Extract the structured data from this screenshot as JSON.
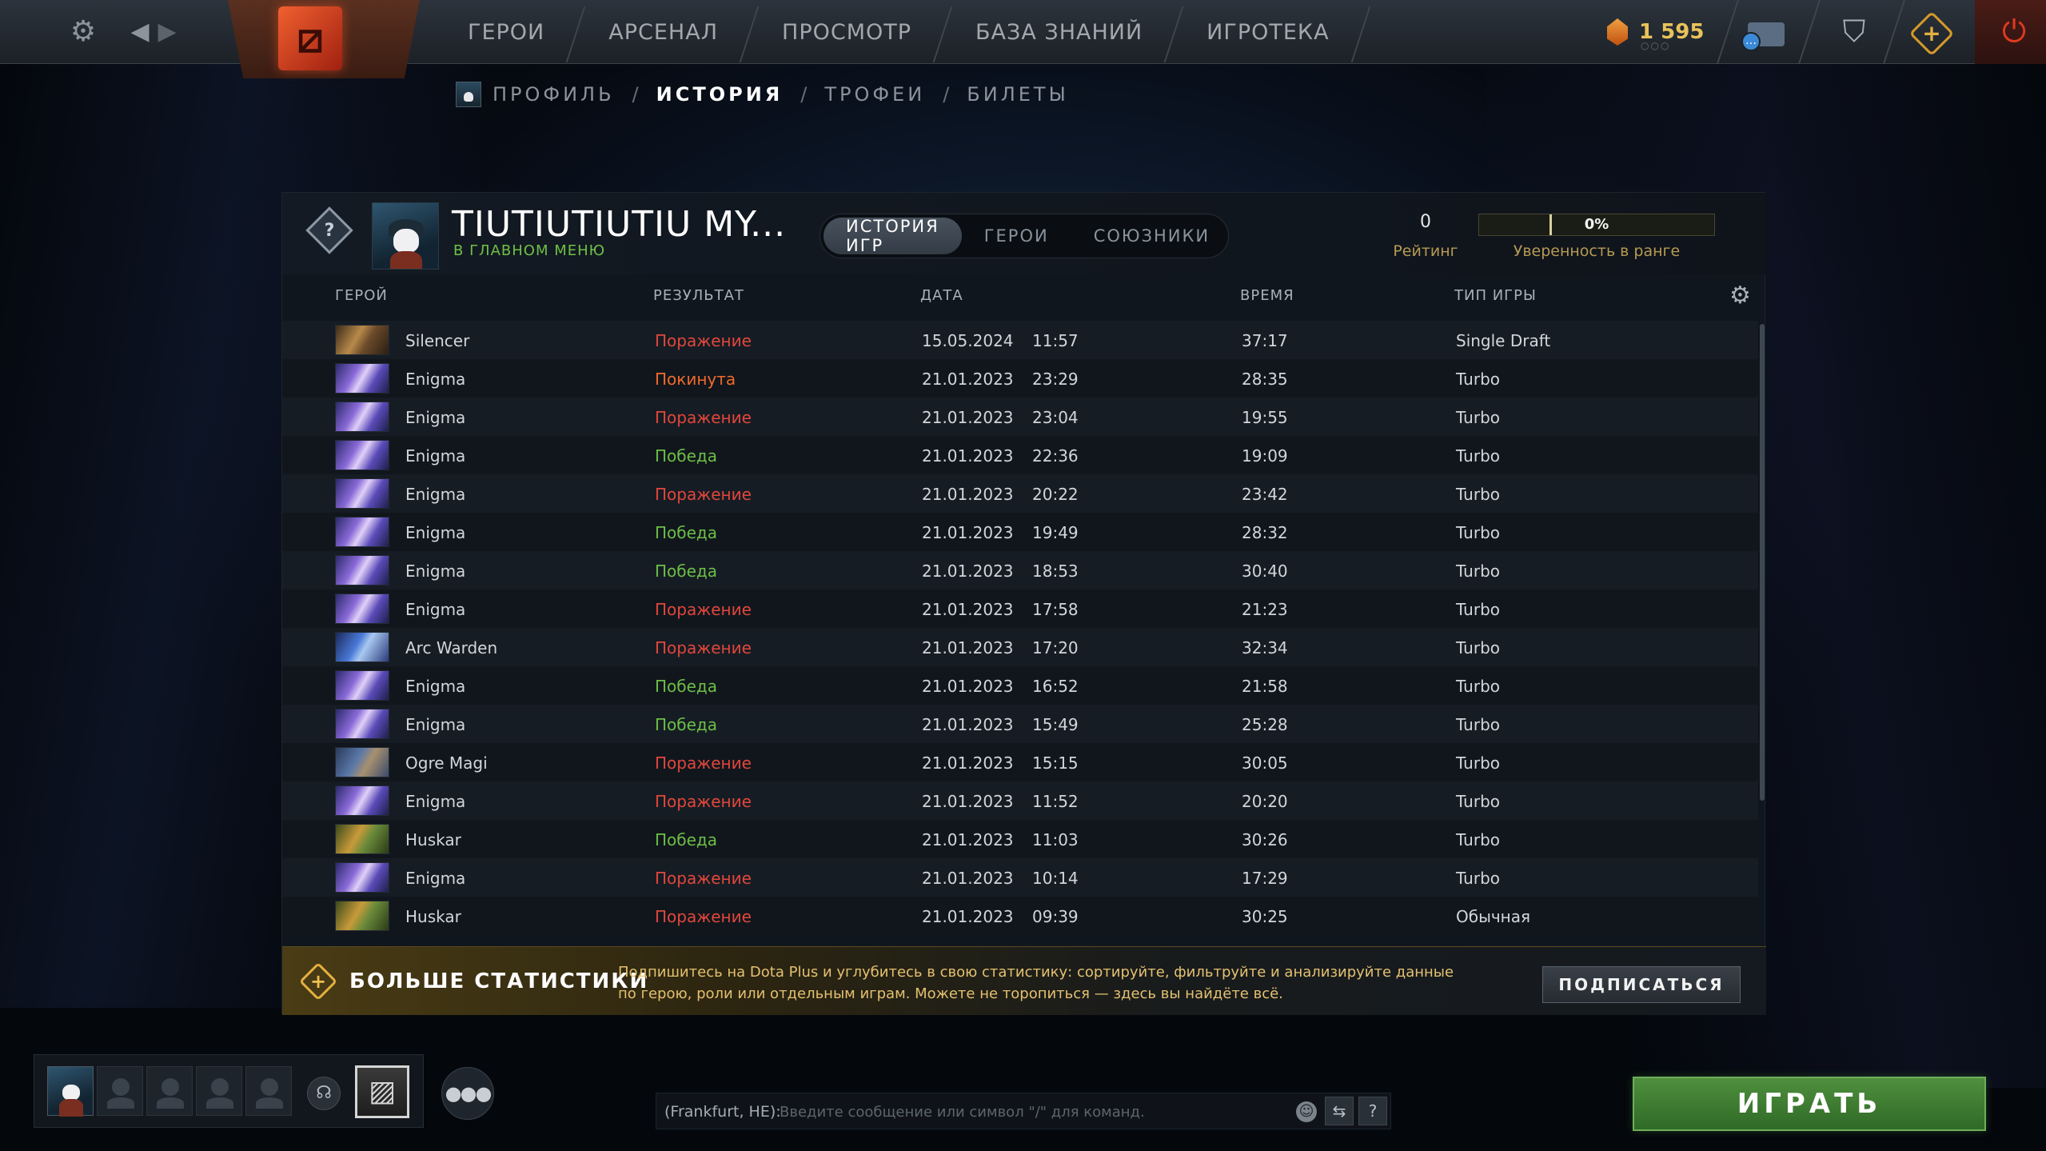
{
  "topbar": {
    "nav": [
      "ГЕРОИ",
      "АРСЕНАЛ",
      "ПРОСМОТР",
      "БАЗА ЗНАНИЙ",
      "ИГРОТЕКА"
    ],
    "currency": "1 595",
    "icons": {
      "settings": "gear-icon",
      "back": "arrow-left-icon",
      "forward": "arrow-right-icon",
      "logo": "dota-logo",
      "shards": "shard-icon",
      "chat": "chat-icon",
      "armory": "armory-icon",
      "dotaplus": "dotaplus-icon",
      "power": "power-icon"
    }
  },
  "subnav": {
    "items": [
      "ПРОФИЛЬ",
      "ИСТОРИЯ",
      "ТРОФЕИ",
      "БИЛЕТЫ"
    ],
    "separator": "/",
    "active": "ИСТОРИЯ"
  },
  "profile": {
    "name": "TIUTIUTIUTIU MY...",
    "status": "В ГЛАВНОМ МЕНЮ",
    "rank_symbol": "?",
    "tabs": [
      "ИСТОРИЯ ИГР",
      "ГЕРОИ",
      "СОЮЗНИКИ"
    ],
    "active_tab": "ИСТОРИЯ ИГР",
    "rating_value": "0",
    "rating_label": "Рейтинг",
    "confidence_value": "0%",
    "confidence_fraction": 0,
    "confidence_label": "Уверенность в ранге"
  },
  "table": {
    "columns": [
      "ГЕРОЙ",
      "РЕЗУЛЬТАТ",
      "ДАТА",
      "ВРЕМЯ",
      "ТИП ИГРЫ"
    ],
    "rows": [
      {
        "hero": "Silencer",
        "img": "silencer",
        "result": "Поражение",
        "rtype": "loss",
        "date": "15.05.2024",
        "time": "11:57",
        "duration": "37:17",
        "mode": "Single Draft"
      },
      {
        "hero": "Enigma",
        "img": "enigma",
        "result": "Покинута",
        "rtype": "abandon",
        "date": "21.01.2023",
        "time": "23:29",
        "duration": "28:35",
        "mode": "Turbo"
      },
      {
        "hero": "Enigma",
        "img": "enigma",
        "result": "Поражение",
        "rtype": "loss",
        "date": "21.01.2023",
        "time": "23:04",
        "duration": "19:55",
        "mode": "Turbo"
      },
      {
        "hero": "Enigma",
        "img": "enigma",
        "result": "Победа",
        "rtype": "win",
        "date": "21.01.2023",
        "time": "22:36",
        "duration": "19:09",
        "mode": "Turbo"
      },
      {
        "hero": "Enigma",
        "img": "enigma",
        "result": "Поражение",
        "rtype": "loss",
        "date": "21.01.2023",
        "time": "20:22",
        "duration": "23:42",
        "mode": "Turbo"
      },
      {
        "hero": "Enigma",
        "img": "enigma",
        "result": "Победа",
        "rtype": "win",
        "date": "21.01.2023",
        "time": "19:49",
        "duration": "28:32",
        "mode": "Turbo"
      },
      {
        "hero": "Enigma",
        "img": "enigma",
        "result": "Победа",
        "rtype": "win",
        "date": "21.01.2023",
        "time": "18:53",
        "duration": "30:40",
        "mode": "Turbo"
      },
      {
        "hero": "Enigma",
        "img": "enigma",
        "result": "Поражение",
        "rtype": "loss",
        "date": "21.01.2023",
        "time": "17:58",
        "duration": "21:23",
        "mode": "Turbo"
      },
      {
        "hero": "Arc Warden",
        "img": "arc",
        "result": "Поражение",
        "rtype": "loss",
        "date": "21.01.2023",
        "time": "17:20",
        "duration": "32:34",
        "mode": "Turbo"
      },
      {
        "hero": "Enigma",
        "img": "enigma",
        "result": "Победа",
        "rtype": "win",
        "date": "21.01.2023",
        "time": "16:52",
        "duration": "21:58",
        "mode": "Turbo"
      },
      {
        "hero": "Enigma",
        "img": "enigma",
        "result": "Победа",
        "rtype": "win",
        "date": "21.01.2023",
        "time": "15:49",
        "duration": "25:28",
        "mode": "Turbo"
      },
      {
        "hero": "Ogre Magi",
        "img": "ogre",
        "result": "Поражение",
        "rtype": "loss",
        "date": "21.01.2023",
        "time": "15:15",
        "duration": "30:05",
        "mode": "Turbo"
      },
      {
        "hero": "Enigma",
        "img": "enigma",
        "result": "Поражение",
        "rtype": "loss",
        "date": "21.01.2023",
        "time": "11:52",
        "duration": "20:20",
        "mode": "Turbo"
      },
      {
        "hero": "Huskar",
        "img": "huskar",
        "result": "Победа",
        "rtype": "win",
        "date": "21.01.2023",
        "time": "11:03",
        "duration": "30:26",
        "mode": "Turbo"
      },
      {
        "hero": "Enigma",
        "img": "enigma",
        "result": "Поражение",
        "rtype": "loss",
        "date": "21.01.2023",
        "time": "10:14",
        "duration": "17:29",
        "mode": "Turbo"
      },
      {
        "hero": "Huskar",
        "img": "huskar",
        "result": "Поражение",
        "rtype": "loss",
        "date": "21.01.2023",
        "time": "09:39",
        "duration": "30:25",
        "mode": "Обычная"
      }
    ]
  },
  "plus_banner": {
    "title": "БОЛЬШЕ СТАТИСТИКИ",
    "description": "Подпишитесь на Dota Plus и углубитесь в свою статистику: сортируйте, фильтруйте и анализируйте данные по герою, роли или отдельным играм. Можете не торопиться — здесь вы найдёте всё.",
    "button": "ПОДПИСАТЬСЯ"
  },
  "bottom": {
    "chat_channel": "(Frankfurt, НЕ):",
    "chat_placeholder": "Введите сообщение или символ \"/\" для команд.",
    "play_button": "ИГРАТЬ"
  },
  "colors": {
    "loss": "#e0473b",
    "win": "#6cbf45",
    "abandon": "#f06a2a",
    "accent_gold": "#b69a52",
    "play_green": "#4f8f3e"
  }
}
